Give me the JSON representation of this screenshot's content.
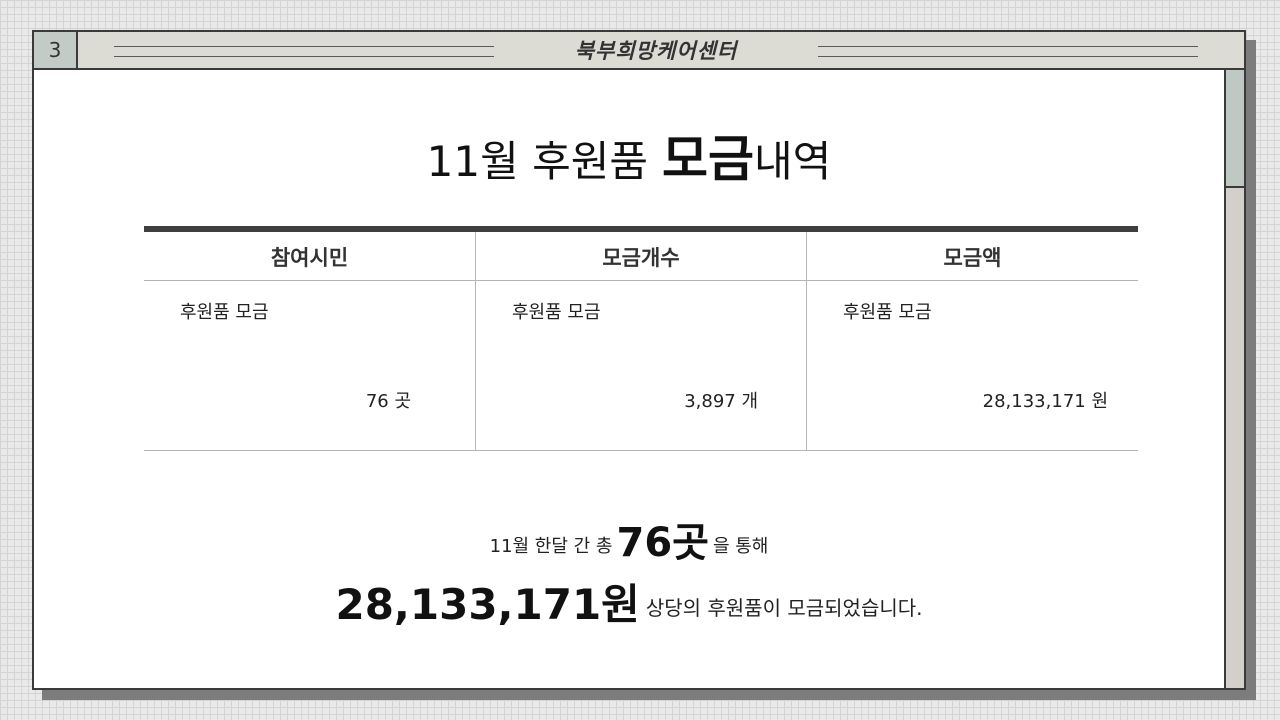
{
  "slide": {
    "page_number": "3",
    "header_title": "북부희망케어센터"
  },
  "heading": {
    "prefix": "11월 후원품",
    "bold": "모금",
    "suffix": "내역"
  },
  "summary_table": {
    "columns": [
      {
        "header": "참여시민",
        "label": "후원품 모금",
        "value": "76 곳"
      },
      {
        "header": "모금개수",
        "label": "후원품 모금",
        "value": "3,897 개"
      },
      {
        "header": "모금액",
        "label": "후원품 모금",
        "value": "28,133,171 원"
      }
    ]
  },
  "summary_text": {
    "line1_before": "11월 한달 간 총",
    "line1_highlight": "76곳",
    "line1_after": "을 통해",
    "line2_highlight": "28,133,171원",
    "line2_after": "상당의 후원품이 모금되었습니다."
  },
  "colors": {
    "titlebar": "#dcdcd5",
    "page_number_bg": "#c2cbc6",
    "border": "#3a3a3a",
    "table_top_rule": "#3f3f3f"
  }
}
